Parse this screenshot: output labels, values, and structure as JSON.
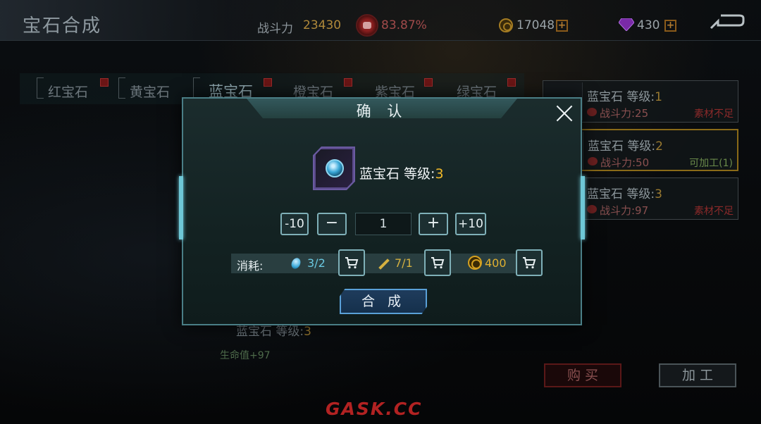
{
  "header": {
    "title": "宝石合成",
    "power_label": "战斗力",
    "power_value": "23430",
    "rate_value": "83.87%",
    "coins": "17048",
    "gems": "430"
  },
  "tabs": [
    {
      "label": "红宝石"
    },
    {
      "label": "黄宝石"
    },
    {
      "label": "蓝宝石"
    },
    {
      "label": "橙宝石"
    },
    {
      "label": "紫宝石"
    },
    {
      "label": "绿宝石"
    }
  ],
  "gem_list": [
    {
      "name": "蓝宝石 等级:",
      "level": "1",
      "power": "战斗力:25",
      "status": "素材不足"
    },
    {
      "name": "蓝宝石 等级:",
      "level": "2",
      "power": "战斗力:50",
      "status": "可加工(1)"
    },
    {
      "name": "蓝宝石 等级:",
      "level": "3",
      "power": "战斗力:97",
      "status": "素材不足"
    }
  ],
  "detail": {
    "name": "蓝宝石 等级:",
    "level": "3",
    "stat": "生命值+97"
  },
  "buttons": {
    "buy": "购 买",
    "craft": "加 工"
  },
  "dialog": {
    "title": "确 认",
    "item_name": "蓝宝石 等级:",
    "item_level": "3",
    "minus10": "-10",
    "minus": "−",
    "quantity": "1",
    "plus": "+",
    "plus10": "+10",
    "cost_label": "消耗:",
    "cost_gem": "3/2",
    "cost_material": "7/1",
    "cost_coin": "400",
    "confirm": "合 成"
  },
  "watermark": "GASK.CC",
  "colors": {
    "accent_teal": "#7fb0b8",
    "level_gold": "#f0b828",
    "warning_red": "#8c2a2a",
    "ok_green": "#6a8a4a",
    "confirm_blue": "#5aa0d8"
  }
}
